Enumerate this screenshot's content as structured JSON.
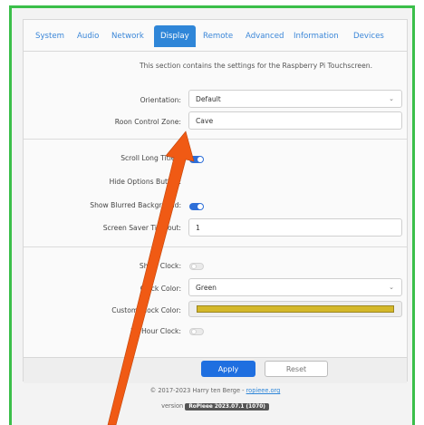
{
  "tabs": [
    {
      "label": "System"
    },
    {
      "label": "Audio"
    },
    {
      "label": "Network"
    },
    {
      "label": "Display",
      "active": true
    },
    {
      "label": "Remote"
    },
    {
      "label": "Advanced"
    },
    {
      "label": "Information"
    },
    {
      "label": "Devices"
    }
  ],
  "intro": "This section contains the settings for the Raspberry Pi Touchscreen.",
  "display": {
    "orientation_label": "Orientation:",
    "orientation_value": "Default",
    "zone_label": "Roon Control Zone:",
    "zone_value": "Cave",
    "scroll_label": "Scroll Long Titles:",
    "scroll_on": true,
    "hide_options_label": "Hide Options Button:",
    "blurred_label": "Show Blurred Background:",
    "blurred_on": true,
    "saver_label": "Screen Saver Timeout:",
    "saver_value": "1"
  },
  "clock": {
    "show_label": "Show Clock:",
    "show_on": false,
    "color_label": "Clock Color:",
    "color_value": "Green",
    "custom_label": "Custom Clock Color:",
    "custom_color": "#d4b82a",
    "h24_label": "24 Hour Clock:",
    "h24_on": false
  },
  "buttons": {
    "apply": "Apply",
    "reset": "Reset"
  },
  "footer": {
    "copyright": "© 2017-2023 Harry ten Berge - ",
    "link": "ropieee.org",
    "version_label": "version",
    "version": "RoPieee 2023.07.1 (1070)"
  },
  "colors": {
    "accent": "#2f86d8",
    "frame": "#3bbf4a",
    "arrow": "#f05a14"
  }
}
